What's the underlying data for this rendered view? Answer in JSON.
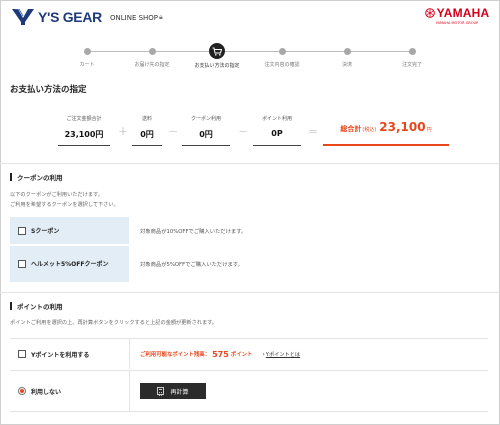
{
  "header": {
    "brand": "Y'S GEAR",
    "shop_label": "ONLINE SHOP",
    "yamaha": "YAMAHA",
    "yamaha_sub": "YAMAHA MOTOR GROUP"
  },
  "steps": [
    {
      "label": "カート"
    },
    {
      "label": "お届け先の指定"
    },
    {
      "label": "お支払い方法の指定"
    },
    {
      "label": "注文内容の確認"
    },
    {
      "label": "決済"
    },
    {
      "label": "注文完了"
    }
  ],
  "page_title": "お支払い方法の指定",
  "summary": {
    "subtotal_label": "ご注文金額合計",
    "subtotal_value": "23,100円",
    "shipping_label": "送料",
    "shipping_value": "0円",
    "coupon_label": "クーポン利用",
    "coupon_value": "0円",
    "points_label": "ポイント利用",
    "points_value": "0P",
    "op_plus1": "+",
    "op_plus2": "+",
    "op_minus1": "−",
    "op_minus2": "−",
    "op_equals": "=",
    "total_label": "総合計",
    "total_tax": "(税込)",
    "total_value": "23,100",
    "total_unit": "円"
  },
  "coupon_section": {
    "title": "クーポンの利用",
    "note_line1": "以下のクーポンがご利用いただけます。",
    "note_line2": "ご利用を希望するクーポンを選択して下さい。",
    "items": [
      {
        "name": "Sクーポン",
        "desc": "対象商品が10%OFFでご購入いただけます。"
      },
      {
        "name": "ヘルメット5%OFFクーポン",
        "desc": "対象商品が5%OFFでご購入いただけます。"
      }
    ]
  },
  "point_section": {
    "title": "ポイントの利用",
    "note": "ポイントご利用を選択の上、再計算ボタンをクリックすると上記の金額が更新されます。",
    "use_label": "Yポイントを利用する",
    "available_label": "ご利用可能なポイント残高：",
    "available_value": "575",
    "available_unit": "ポイント",
    "link_text": "Yポイントとは",
    "no_use_label": "利用しない",
    "recalc_label": "再計算"
  },
  "colors": {
    "accent": "#e8471c",
    "brand_blue": "#1e3a7a",
    "yamaha_red": "#d3001b"
  }
}
